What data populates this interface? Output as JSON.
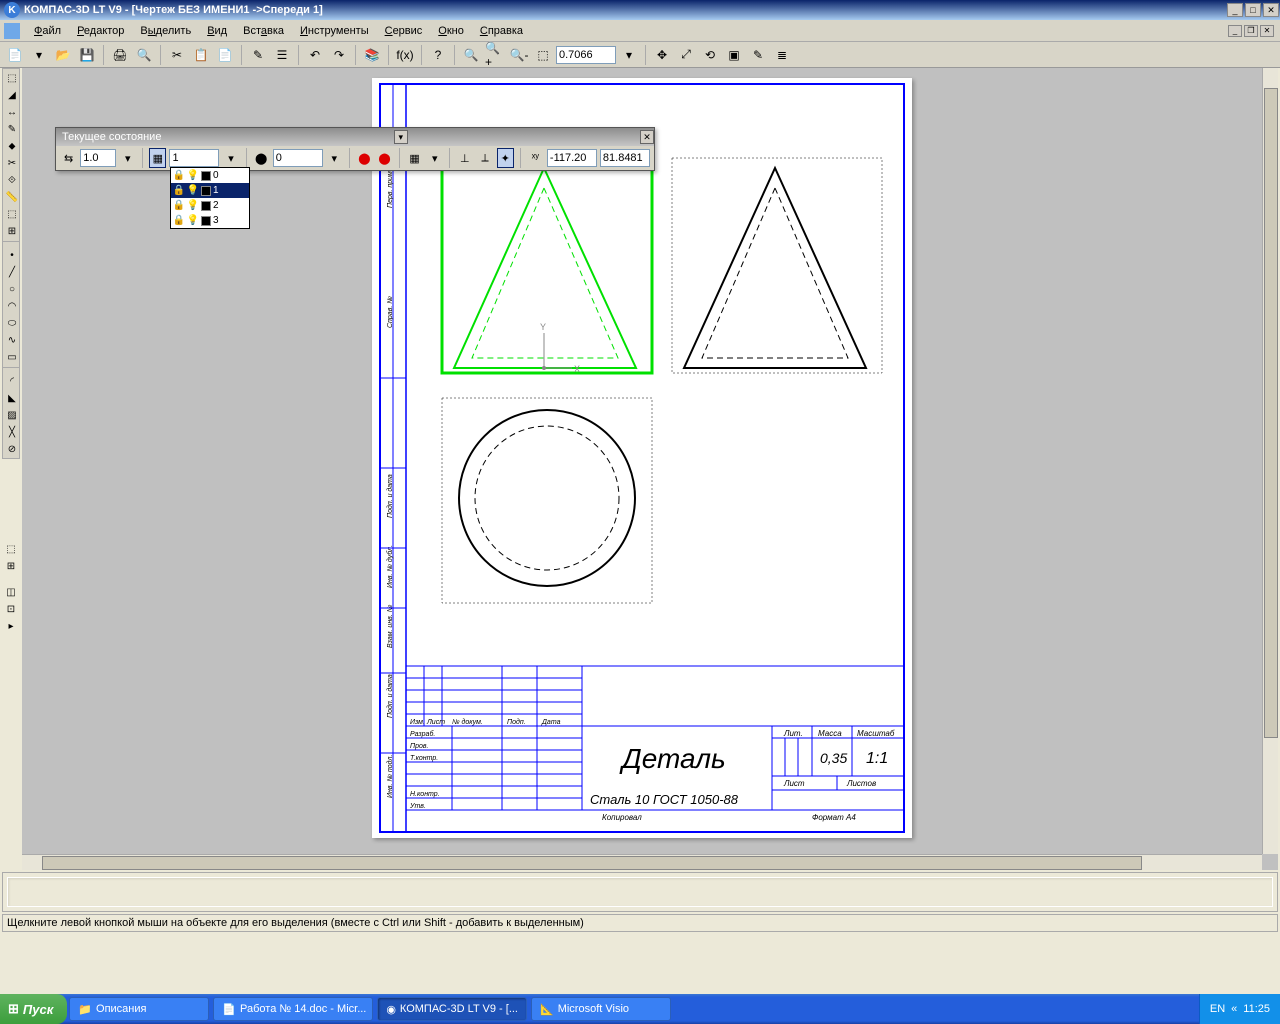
{
  "titlebar": {
    "text": "КОМПАС-3D LT V9 - [Чертеж БЕЗ ИМЕНИ1 ->Спереди 1]"
  },
  "menu": {
    "items": [
      "Файл",
      "Редактор",
      "Выделить",
      "Вид",
      "Вставка",
      "Инструменты",
      "Сервис",
      "Окно",
      "Справка"
    ]
  },
  "toolbar2": {
    "zoom": "0.7066"
  },
  "floatbar": {
    "title": "Текущее состояние",
    "step": "1.0",
    "layer_current": "1",
    "style": "0",
    "coord_x": "-117.20",
    "coord_y": "81.8481"
  },
  "layers": {
    "items": [
      {
        "num": "0",
        "sel": false
      },
      {
        "num": "1",
        "sel": true
      },
      {
        "num": "2",
        "sel": false
      },
      {
        "num": "3",
        "sel": false
      }
    ]
  },
  "titleblock": {
    "part": "Деталь",
    "material": "Сталь 10  ГОСТ 1050-88",
    "lit": "Лит.",
    "massa": "Масса",
    "massa_val": "0,35",
    "scale": "Масштаб",
    "scale_val": "1:1",
    "list": "Лист",
    "listov": "Листов",
    "kopiroval": "Копировал",
    "format": "Формат",
    "format_val": "А4",
    "rows": [
      "Изм.",
      "Лист",
      "№ докум.",
      "Подп.",
      "Дата"
    ],
    "leftrows": [
      "Разраб.",
      "Пров.",
      "Т.контр.",
      "",
      "Н.контр.",
      "Утв."
    ]
  },
  "status": {
    "text": "Щелкните левой кнопкой мыши на объекте для его выделения (вместе с Ctrl или Shift - добавить к выделенным)"
  },
  "taskbar": {
    "start": "Пуск",
    "items": [
      {
        "label": "Описания",
        "icon": "📁",
        "active": false
      },
      {
        "label": "Работа № 14.doc - Micr...",
        "icon": "📄",
        "active": false
      },
      {
        "label": "КОМПАС-3D LT V9 - [...",
        "icon": "◉",
        "active": true
      },
      {
        "label": "Microsoft Visio",
        "icon": "📐",
        "active": false
      }
    ],
    "lang": "EN",
    "time": "11:25"
  }
}
